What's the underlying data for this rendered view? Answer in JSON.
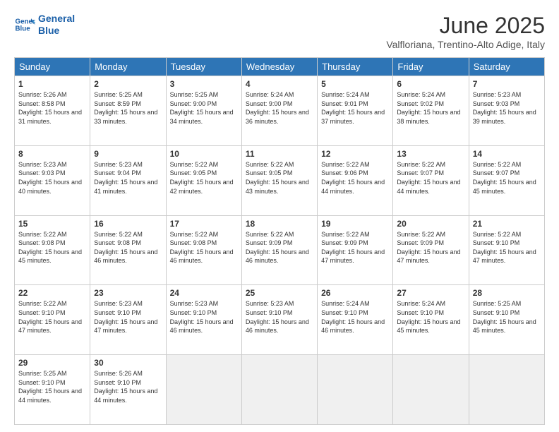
{
  "logo": {
    "line1": "General",
    "line2": "Blue"
  },
  "title": "June 2025",
  "subtitle": "Valfloriana, Trentino-Alto Adige, Italy",
  "headers": [
    "Sunday",
    "Monday",
    "Tuesday",
    "Wednesday",
    "Thursday",
    "Friday",
    "Saturday"
  ],
  "days": [
    {
      "num": "",
      "info": ""
    },
    {
      "num": "",
      "info": ""
    },
    {
      "num": "",
      "info": ""
    },
    {
      "num": "",
      "info": ""
    },
    {
      "num": "",
      "info": ""
    },
    {
      "num": "",
      "info": ""
    },
    {
      "num": "7",
      "sunrise": "Sunrise: 5:23 AM",
      "sunset": "Sunset: 9:03 PM",
      "daylight": "Daylight: 15 hours and 39 minutes."
    },
    {
      "num": "1",
      "sunrise": "Sunrise: 5:26 AM",
      "sunset": "Sunset: 8:58 PM",
      "daylight": "Daylight: 15 hours and 31 minutes."
    },
    {
      "num": "2",
      "sunrise": "Sunrise: 5:25 AM",
      "sunset": "Sunset: 8:59 PM",
      "daylight": "Daylight: 15 hours and 33 minutes."
    },
    {
      "num": "3",
      "sunrise": "Sunrise: 5:25 AM",
      "sunset": "Sunset: 9:00 PM",
      "daylight": "Daylight: 15 hours and 34 minutes."
    },
    {
      "num": "4",
      "sunrise": "Sunrise: 5:24 AM",
      "sunset": "Sunset: 9:00 PM",
      "daylight": "Daylight: 15 hours and 36 minutes."
    },
    {
      "num": "5",
      "sunrise": "Sunrise: 5:24 AM",
      "sunset": "Sunset: 9:01 PM",
      "daylight": "Daylight: 15 hours and 37 minutes."
    },
    {
      "num": "6",
      "sunrise": "Sunrise: 5:24 AM",
      "sunset": "Sunset: 9:02 PM",
      "daylight": "Daylight: 15 hours and 38 minutes."
    },
    {
      "num": "7",
      "sunrise": "Sunrise: 5:23 AM",
      "sunset": "Sunset: 9:03 PM",
      "daylight": "Daylight: 15 hours and 39 minutes."
    },
    {
      "num": "8",
      "sunrise": "Sunrise: 5:23 AM",
      "sunset": "Sunset: 9:03 PM",
      "daylight": "Daylight: 15 hours and 40 minutes."
    },
    {
      "num": "9",
      "sunrise": "Sunrise: 5:23 AM",
      "sunset": "Sunset: 9:04 PM",
      "daylight": "Daylight: 15 hours and 41 minutes."
    },
    {
      "num": "10",
      "sunrise": "Sunrise: 5:22 AM",
      "sunset": "Sunset: 9:05 PM",
      "daylight": "Daylight: 15 hours and 42 minutes."
    },
    {
      "num": "11",
      "sunrise": "Sunrise: 5:22 AM",
      "sunset": "Sunset: 9:05 PM",
      "daylight": "Daylight: 15 hours and 43 minutes."
    },
    {
      "num": "12",
      "sunrise": "Sunrise: 5:22 AM",
      "sunset": "Sunset: 9:06 PM",
      "daylight": "Daylight: 15 hours and 44 minutes."
    },
    {
      "num": "13",
      "sunrise": "Sunrise: 5:22 AM",
      "sunset": "Sunset: 9:07 PM",
      "daylight": "Daylight: 15 hours and 44 minutes."
    },
    {
      "num": "14",
      "sunrise": "Sunrise: 5:22 AM",
      "sunset": "Sunset: 9:07 PM",
      "daylight": "Daylight: 15 hours and 45 minutes."
    },
    {
      "num": "15",
      "sunrise": "Sunrise: 5:22 AM",
      "sunset": "Sunset: 9:08 PM",
      "daylight": "Daylight: 15 hours and 45 minutes."
    },
    {
      "num": "16",
      "sunrise": "Sunrise: 5:22 AM",
      "sunset": "Sunset: 9:08 PM",
      "daylight": "Daylight: 15 hours and 46 minutes."
    },
    {
      "num": "17",
      "sunrise": "Sunrise: 5:22 AM",
      "sunset": "Sunset: 9:08 PM",
      "daylight": "Daylight: 15 hours and 46 minutes."
    },
    {
      "num": "18",
      "sunrise": "Sunrise: 5:22 AM",
      "sunset": "Sunset: 9:09 PM",
      "daylight": "Daylight: 15 hours and 46 minutes."
    },
    {
      "num": "19",
      "sunrise": "Sunrise: 5:22 AM",
      "sunset": "Sunset: 9:09 PM",
      "daylight": "Daylight: 15 hours and 47 minutes."
    },
    {
      "num": "20",
      "sunrise": "Sunrise: 5:22 AM",
      "sunset": "Sunset: 9:09 PM",
      "daylight": "Daylight: 15 hours and 47 minutes."
    },
    {
      "num": "21",
      "sunrise": "Sunrise: 5:22 AM",
      "sunset": "Sunset: 9:10 PM",
      "daylight": "Daylight: 15 hours and 47 minutes."
    },
    {
      "num": "22",
      "sunrise": "Sunrise: 5:22 AM",
      "sunset": "Sunset: 9:10 PM",
      "daylight": "Daylight: 15 hours and 47 minutes."
    },
    {
      "num": "23",
      "sunrise": "Sunrise: 5:23 AM",
      "sunset": "Sunset: 9:10 PM",
      "daylight": "Daylight: 15 hours and 47 minutes."
    },
    {
      "num": "24",
      "sunrise": "Sunrise: 5:23 AM",
      "sunset": "Sunset: 9:10 PM",
      "daylight": "Daylight: 15 hours and 46 minutes."
    },
    {
      "num": "25",
      "sunrise": "Sunrise: 5:23 AM",
      "sunset": "Sunset: 9:10 PM",
      "daylight": "Daylight: 15 hours and 46 minutes."
    },
    {
      "num": "26",
      "sunrise": "Sunrise: 5:24 AM",
      "sunset": "Sunset: 9:10 PM",
      "daylight": "Daylight: 15 hours and 46 minutes."
    },
    {
      "num": "27",
      "sunrise": "Sunrise: 5:24 AM",
      "sunset": "Sunset: 9:10 PM",
      "daylight": "Daylight: 15 hours and 45 minutes."
    },
    {
      "num": "28",
      "sunrise": "Sunrise: 5:25 AM",
      "sunset": "Sunset: 9:10 PM",
      "daylight": "Daylight: 15 hours and 45 minutes."
    },
    {
      "num": "29",
      "sunrise": "Sunrise: 5:25 AM",
      "sunset": "Sunset: 9:10 PM",
      "daylight": "Daylight: 15 hours and 44 minutes."
    },
    {
      "num": "30",
      "sunrise": "Sunrise: 5:26 AM",
      "sunset": "Sunset: 9:10 PM",
      "daylight": "Daylight: 15 hours and 44 minutes."
    }
  ]
}
